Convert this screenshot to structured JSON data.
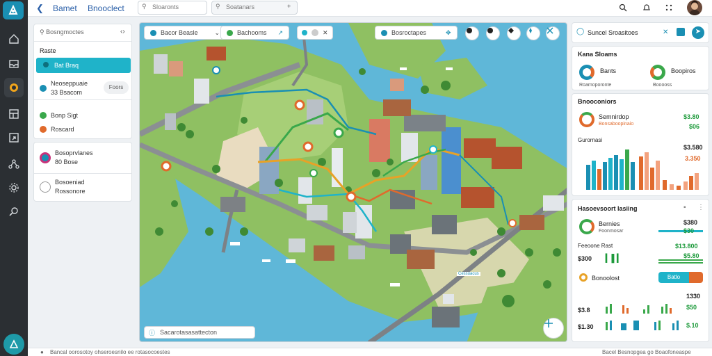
{
  "topbar": {
    "title": "Bamet",
    "subtitle": "Bnooclect",
    "search_placeholder": "Sloaronts",
    "filter_placeholder": "Soatanars"
  },
  "left_panel": {
    "search_placeholder": "Bosngmoctes",
    "section_label": "Raste",
    "active_item": "Bat Braq",
    "item_1": {
      "title": "Neoseppuaie",
      "sub": "33 Bsacom",
      "badge": "Foors"
    },
    "item_2": "Bonp Sigt",
    "item_3": "Roscard",
    "item_4": {
      "title": "Bosoprvlanes",
      "sub": "80 Bose"
    },
    "item_5": {
      "title": "Bosoeniad",
      "sub": "Rossonore"
    }
  },
  "map": {
    "chip_1": "Bacor Beasle",
    "chip_2": "Bachooms",
    "chip_3": "Bosroctapes",
    "bottom_search": "Sacarotasasattecton",
    "place_label": "Cessuacus"
  },
  "right_panel": {
    "header": "Suncel Sroasitoes",
    "kpi_title": "Kana Sloams",
    "kpi_1": {
      "label": "Bants",
      "sub": "Roamoporonte"
    },
    "kpi_2": {
      "label": "Boopiros",
      "sub": "Booooss"
    },
    "section_2_title": "Bnooconiors",
    "s2_row_1": {
      "label": "Semnirdop",
      "sub": "Bonsaboopinaio"
    },
    "s2_val_1": "$3.80",
    "s2_val_2": "$06",
    "s2_label_bars": "Gurornasi",
    "s2_val_3": "$3.580",
    "s2_val_4": "3.350",
    "section_3_title": "Hasoevsoort lasiing",
    "s3_row_1": {
      "label": "Bernies",
      "sub": "Foonmosar"
    },
    "s3_val_1": "$380",
    "s3_val_2": "$30",
    "s3_row_2_label": "Feeoone Rast",
    "s3_val_3": "$13.800",
    "s3_val_4": "$300",
    "s3_val_5": "$5.80",
    "s3_row_3_label": "Bonoolost",
    "s3_btn": "Batlo",
    "s3_val_6": "1330",
    "s3_val_7": "$3.8",
    "s3_val_8": "$50",
    "s3_val_9": "$1.30",
    "s3_val_10": "$.10"
  },
  "status": {
    "left": "Bancal oorosotoy ohseroesnilo ee rotasocoestes",
    "right": "Bacel Besnopgea go Boaofoneaspe"
  },
  "colors": {
    "accent": "#1fb3c9",
    "green": "#1d9a3b",
    "orange": "#e06a2c",
    "blue": "#1a8fb3"
  }
}
